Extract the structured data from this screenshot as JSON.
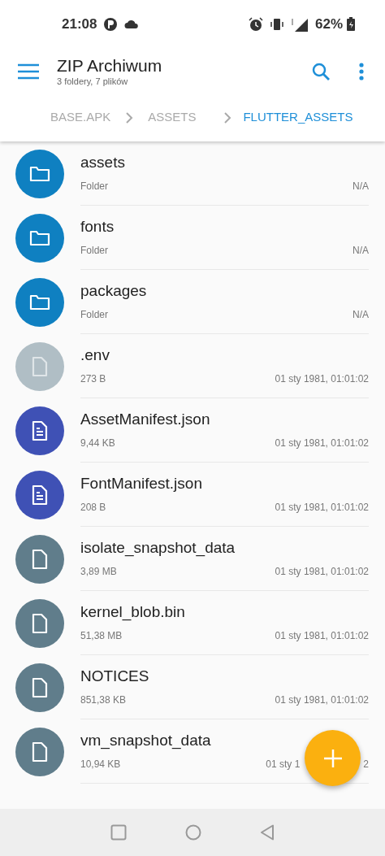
{
  "status_bar": {
    "time": "21:08",
    "battery": "62%"
  },
  "app_bar": {
    "title": "ZIP Archiwum",
    "subtitle": "3 foldery, 7 plików"
  },
  "breadcrumbs": [
    {
      "label": "BASE.APK",
      "selected": false
    },
    {
      "label": "ASSETS",
      "selected": false
    },
    {
      "label": "FLUTTER_ASSETS",
      "selected": true
    }
  ],
  "files": [
    {
      "kind": "folder",
      "color": "#0f80c1",
      "name": "assets",
      "size": "Folder",
      "date": "N/A"
    },
    {
      "kind": "folder",
      "color": "#0f80c1",
      "name": "fonts",
      "size": "Folder",
      "date": "N/A"
    },
    {
      "kind": "folder",
      "color": "#0f80c1",
      "name": "packages",
      "size": "Folder",
      "date": "N/A"
    },
    {
      "kind": "file",
      "color": "#b0bec5",
      "name": ".env",
      "size": "273 B",
      "date": "01 sty 1981, 01:01:02"
    },
    {
      "kind": "document",
      "color": "#3f51b5",
      "name": "AssetManifest.json",
      "size": "9,44 KB",
      "date": "01 sty 1981, 01:01:02"
    },
    {
      "kind": "document",
      "color": "#3f51b5",
      "name": "FontManifest.json",
      "size": "208 B",
      "date": "01 sty 1981, 01:01:02"
    },
    {
      "kind": "file",
      "color": "#607d8b",
      "name": "isolate_snapshot_data",
      "size": "3,89 MB",
      "date": "01 sty 1981, 01:01:02"
    },
    {
      "kind": "file",
      "color": "#607d8b",
      "name": "kernel_blob.bin",
      "size": "51,38 MB",
      "date": "01 sty 1981, 01:01:02"
    },
    {
      "kind": "file",
      "color": "#607d8b",
      "name": "NOTICES",
      "size": "851,38 KB",
      "date": "01 sty 1981, 01:01:02"
    },
    {
      "kind": "file",
      "color": "#607d8b",
      "name": "vm_snapshot_data",
      "size": "10,94 KB",
      "date": "01 sty 1",
      "date_tail": "2"
    }
  ]
}
